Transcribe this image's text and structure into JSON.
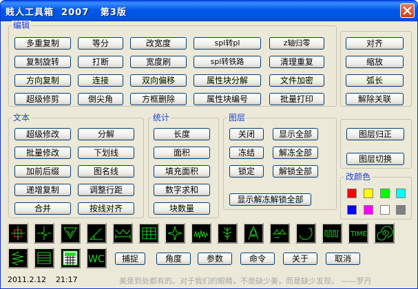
{
  "window": {
    "title": "贱人工具箱  2007   第3版",
    "close_icon": "close-icon"
  },
  "edit_group": {
    "label": "编辑",
    "rows": [
      [
        "多重复制",
        "等分",
        "改宽度",
        "spl转pl",
        "z轴归零"
      ],
      [
        "复制旋转",
        "打断",
        "宽度刷",
        "spl转铁路",
        "清理重复"
      ],
      [
        "方向复制",
        "连接",
        "双向偏移",
        "属性块分解",
        "文件加密"
      ],
      [
        "超级修剪",
        "倒尖角",
        "方框删除",
        "属性块编号",
        "批量打印"
      ]
    ]
  },
  "right_group": {
    "buttons": [
      "对齐",
      "缩放",
      "弧长",
      "解除关联"
    ]
  },
  "text_group": {
    "label": "文本",
    "left": [
      "超级修改",
      "批量修改",
      "加前后缀",
      "递增复制",
      "合并"
    ],
    "right": [
      "分解",
      "下划线",
      "图名线",
      "调整行距",
      "按线对齐"
    ]
  },
  "stats_group": {
    "label": "统计",
    "buttons": [
      "长度",
      "面积",
      "填充面积",
      "数字求和",
      "块数量"
    ]
  },
  "layer_group": {
    "label": "图层",
    "left": [
      "关闭",
      "冻结",
      "锁定"
    ],
    "right": [
      "显示全部",
      "解冻全部",
      "解锁全部"
    ],
    "wide": "显示解冻解锁全部"
  },
  "layer_tools_group": {
    "buttons": [
      "图层归正",
      "图层切换"
    ]
  },
  "color_group": {
    "label": "改颜色",
    "swatches": [
      "#ff0000",
      "#ffff00",
      "#00ff00",
      "#00ffff",
      "#0000ff",
      "#ff00ff",
      "#ffffff",
      "#808080"
    ]
  },
  "icon_tools": {
    "row1": [
      "crosshair-snap-icon",
      "break-line-icon",
      "triangle-mark-icon",
      "angle-icon",
      "dimension-icon",
      "table-grid-icon",
      "star-shape-icon",
      "wave-line-icon",
      "tree-icon",
      "compass-icon",
      "level-mark-icon",
      "arc-arrow-icon",
      "zigzag-icon",
      "time-text-icon",
      "spiral-icon"
    ],
    "row2": [
      "spring-icon",
      "stack-lines-icon",
      "calculator-icon",
      "wc-text-icon"
    ],
    "time_text": "TIME",
    "wc_text": "WC"
  },
  "bottom_buttons": [
    "捕捉",
    "角度",
    "参数",
    "命令",
    "关于",
    "取消"
  ],
  "status": {
    "datetime": "2011.2.12    21:17",
    "quote": "美是到处都有的。对于我们的眼睛，不是缺少美，而是缺少发现。 ——罗丹"
  }
}
